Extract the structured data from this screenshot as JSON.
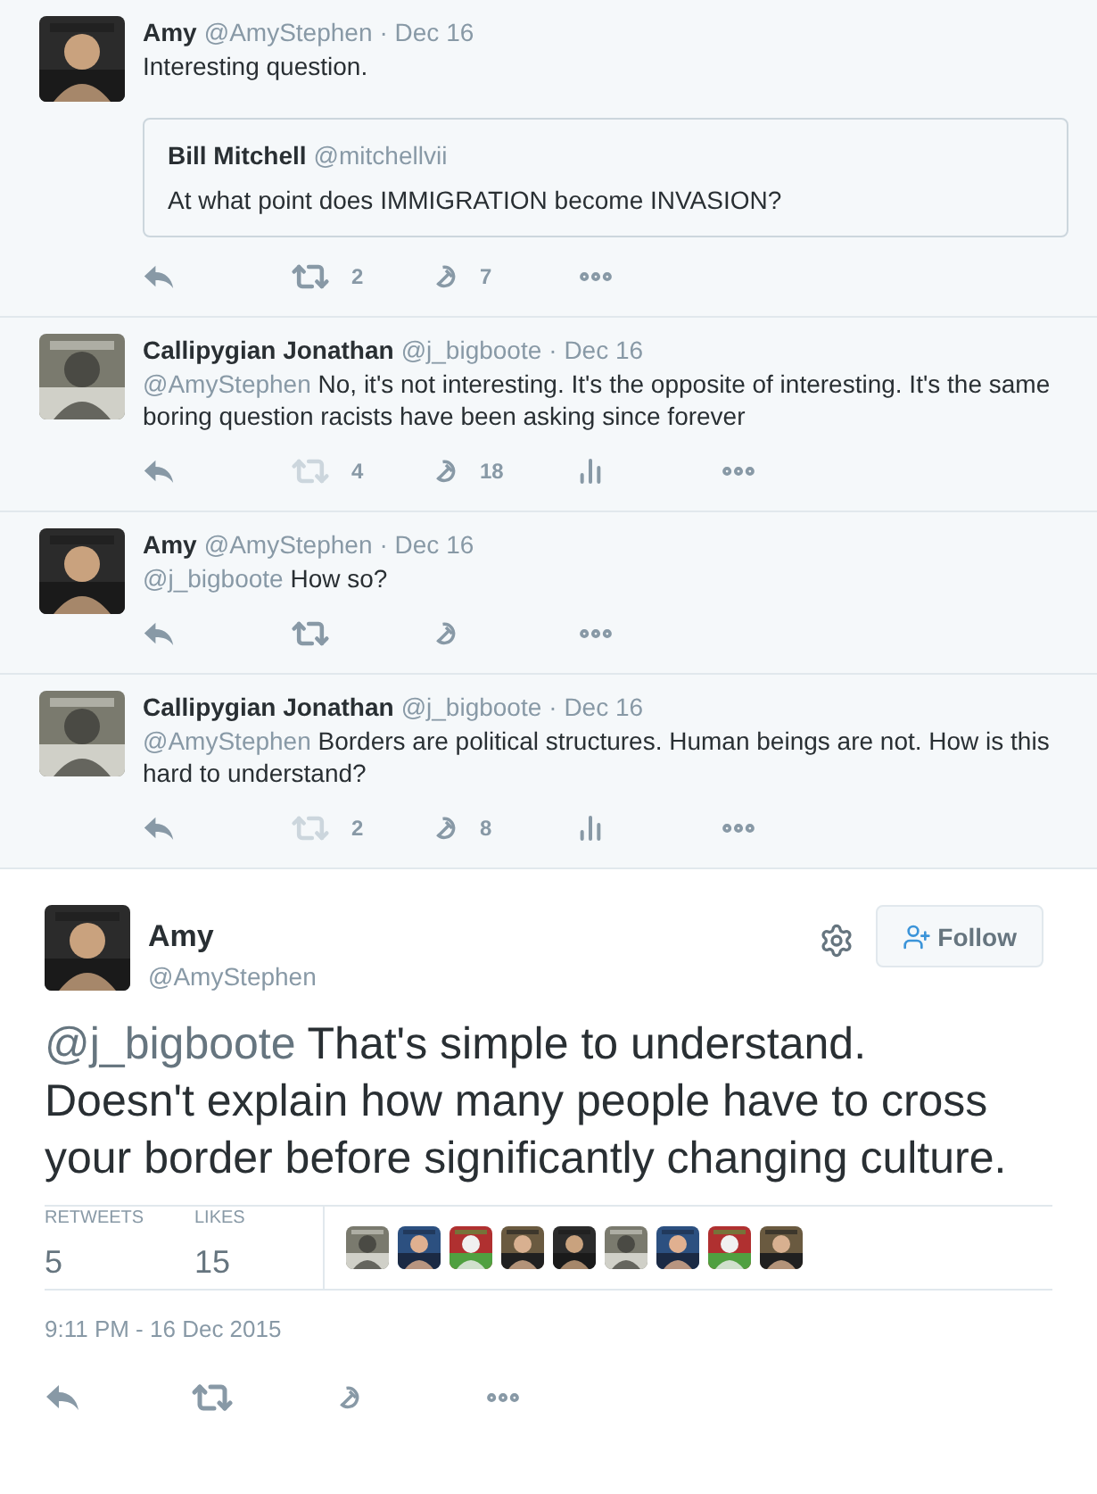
{
  "replies": [
    {
      "name": "Amy",
      "handle": "@AmyStephen",
      "date": "· Dec 16",
      "text": "Interesting question.",
      "quote": {
        "name": "Bill Mitchell",
        "handle": "@mitchellvii",
        "text": "At what point does IMMIGRATION become INVASION?"
      },
      "retweets": "2",
      "likes": "7",
      "analytics": false,
      "retweet_muted": false
    },
    {
      "name": "Callipygian Jonathan",
      "handle": "@j_bigboote",
      "date": "· Dec 16",
      "mention": "@AmyStephen",
      "text": "No, it's not interesting. It's the opposite of interesting. It's the same boring question racists have been asking since forever",
      "retweets": "4",
      "likes": "18",
      "analytics": true,
      "retweet_muted": true
    },
    {
      "name": "Amy",
      "handle": "@AmyStephen",
      "date": "· Dec 16",
      "mention": "@j_bigboote",
      "text": "How so?",
      "analytics": false,
      "retweet_muted": false
    },
    {
      "name": "Callipygian Jonathan",
      "handle": "@j_bigboote",
      "date": "· Dec 16",
      "mention": "@AmyStephen",
      "text": "Borders are political structures. Human beings are not. How is this hard to understand?",
      "retweets": "2",
      "likes": "8",
      "analytics": true,
      "retweet_muted": true
    }
  ],
  "main_tweet": {
    "name": "Amy",
    "handle": "@AmyStephen",
    "follow_label": "Follow",
    "mention": "@j_bigboote",
    "text": "That's simple to understand. Doesn't explain how many people have to cross your border before significantly changing culture.",
    "stats": [
      {
        "label": "RETWEETS",
        "value": "5"
      },
      {
        "label": "LIKES",
        "value": "15"
      }
    ],
    "timestamp": "9:11 PM - 16 Dec 2015"
  }
}
